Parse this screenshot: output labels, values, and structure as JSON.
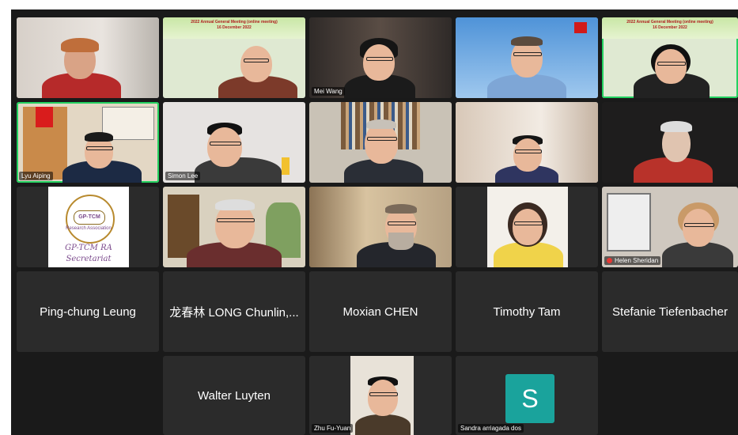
{
  "meeting": {
    "banner_line1": "2022 Annual General Meeting (online meeting)",
    "banner_line2": "16 December 2022"
  },
  "tiles": [
    {
      "id": "t1",
      "name": ""
    },
    {
      "id": "t2",
      "name": ""
    },
    {
      "id": "t3",
      "name": "Mei Wang"
    },
    {
      "id": "t4",
      "name": ""
    },
    {
      "id": "t5",
      "name": ""
    },
    {
      "id": "t6",
      "name": "Lyu Aiping"
    },
    {
      "id": "t7",
      "name": "Simon Lee"
    },
    {
      "id": "t8",
      "name": ""
    },
    {
      "id": "t9",
      "name": ""
    },
    {
      "id": "t10",
      "name": ""
    },
    {
      "id": "t11",
      "name": ""
    },
    {
      "id": "t12",
      "name": ""
    },
    {
      "id": "t13",
      "name": ""
    },
    {
      "id": "t14",
      "name": ""
    },
    {
      "id": "t15",
      "name": "Helen Sheridan"
    },
    {
      "id": "t16",
      "name": "Ping-chung Leung"
    },
    {
      "id": "t17",
      "name": "龙春林 LONG Chunlin,..."
    },
    {
      "id": "t18",
      "name": "Moxian CHEN"
    },
    {
      "id": "t19",
      "name": "Timothy Tam"
    },
    {
      "id": "t20",
      "name": "Stefanie Tiefenbacher"
    },
    {
      "id": "t21",
      "name": "Walter Luyten"
    },
    {
      "id": "t22",
      "name": "Zhu Fu-Yuan"
    },
    {
      "id": "t23",
      "name": "Sandra arriagada dos",
      "avatar_letter": "S"
    }
  ],
  "gp_tcm_logo": {
    "circle_text": "GP-TCM",
    "arc_text": "Research Association",
    "caption_line1": "GP-TCM RA",
    "caption_line2": "Secretariat"
  },
  "colors": {
    "active_speaker_border": "#23d160",
    "tile_background": "#2b2b2b",
    "avatar_teal": "#1aa39c",
    "muted_mic": "#e53935"
  }
}
